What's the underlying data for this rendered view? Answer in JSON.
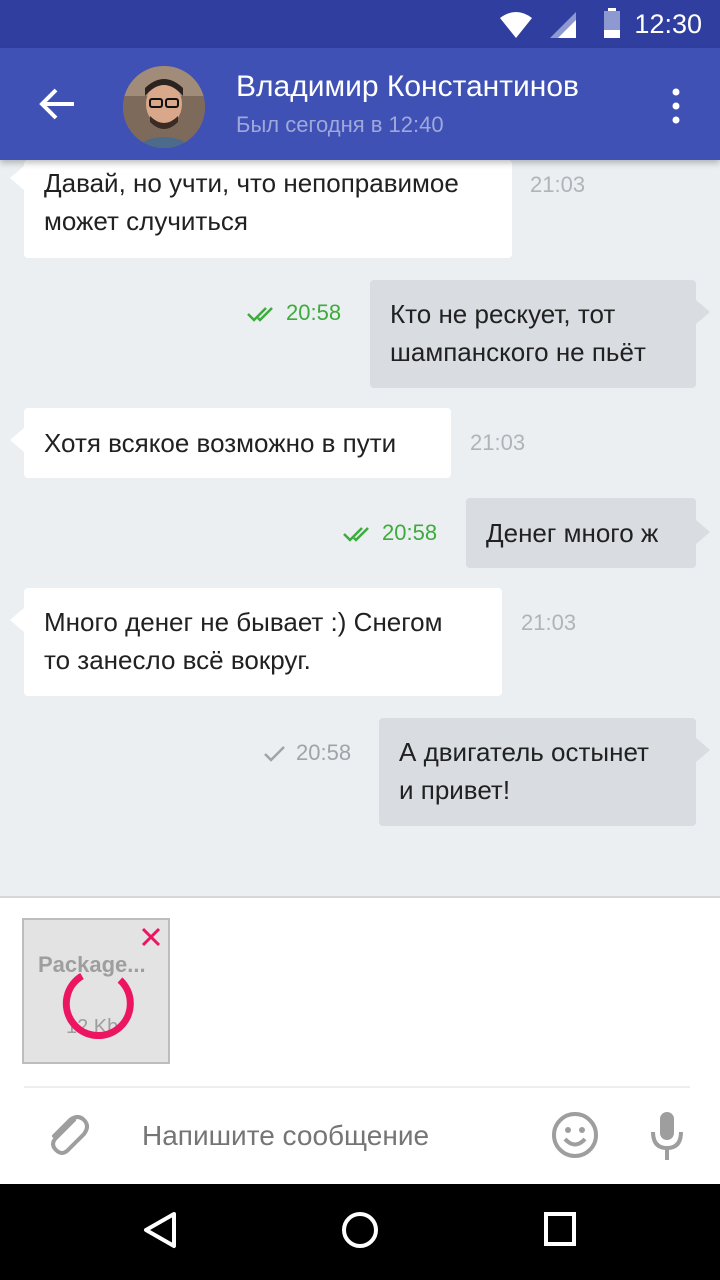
{
  "status_bar": {
    "time": "12:30"
  },
  "toolbar": {
    "contact_name": "Владимир Константинов",
    "last_seen": "Был сегодня в 12:40"
  },
  "messages": [
    {
      "direction": "in",
      "text": "Давай, но учти, что непоправимое\nможет случиться",
      "time": "21:03"
    },
    {
      "direction": "out",
      "text": "Кто не рескует, тот\nшампанского не пьёт",
      "time": "20:58",
      "status": "read"
    },
    {
      "direction": "in",
      "text": "Хотя всякое возможно в пути",
      "time": "21:03"
    },
    {
      "direction": "out",
      "text": "Денег много ж",
      "time": "20:58",
      "status": "read"
    },
    {
      "direction": "in",
      "text": "Много денег не бывает :)  Снегом\nто занесло всё вокруг.",
      "time": "21:03"
    },
    {
      "direction": "out",
      "text": "А двигатель остынет\nи привет!",
      "time": "20:58",
      "status": "sent"
    }
  ],
  "attachment": {
    "file_name": "Package...",
    "file_size": "12 Kb",
    "upload_status": "uploading"
  },
  "composer": {
    "placeholder": "Напишите сообщение"
  },
  "colors": {
    "primary": "#3f51b5",
    "primary_dark": "#303f9f",
    "read_green": "#3dab3d",
    "accent": "#ec1561",
    "outgoing_bubble": "#d9dde2",
    "chat_bg": "#eceff1"
  },
  "icons": [
    "wifi-icon",
    "signal-icon",
    "battery-icon",
    "back-arrow-icon",
    "more-vert-icon",
    "double-check-icon",
    "single-check-icon",
    "close-icon",
    "paperclip-icon",
    "smiley-icon",
    "microphone-icon",
    "nav-back-icon",
    "nav-home-icon",
    "nav-recents-icon"
  ]
}
